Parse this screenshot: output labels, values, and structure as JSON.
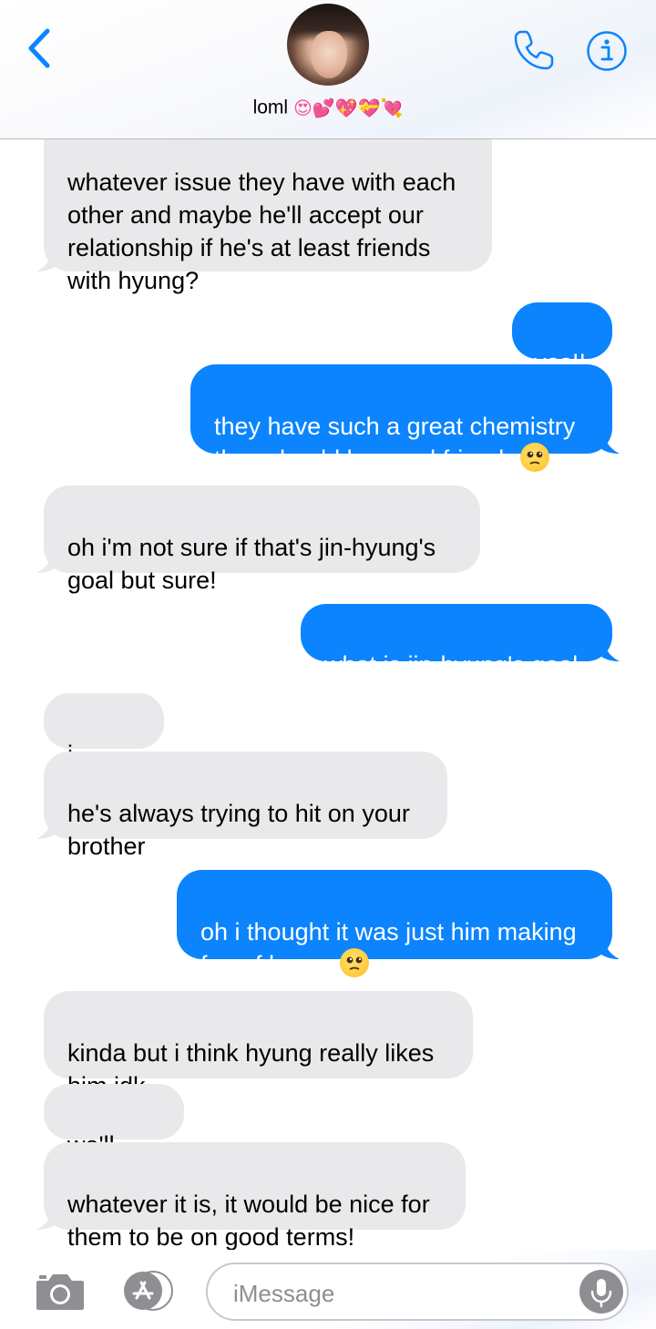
{
  "header": {
    "contact_name": "loml",
    "contact_emojis": "😍💕💖💝💘",
    "avatar_label": "contact photo"
  },
  "messages": [
    {
      "direction": "in",
      "text": "whatever issue they have with each\nother and maybe he'll accept our\nrelationship if he's at least friends\nwith hyung?"
    },
    {
      "direction": "out",
      "text": "yes!!"
    },
    {
      "direction": "out",
      "text": "they have such a great chemistry\nthey should be good friends",
      "emoji": "🥺"
    },
    {
      "direction": "in",
      "text": "oh i'm not sure if that's jin-hyung's\ngoal but sure!"
    },
    {
      "direction": "out",
      "text": "what is jin-hyung's goal"
    },
    {
      "direction": "in",
      "text": "i mean"
    },
    {
      "direction": "in",
      "text": "he's always trying to hit on your\nbrother"
    },
    {
      "direction": "out",
      "text": "oh i thought it was just him making\nfun of hyung",
      "emoji": "😂"
    },
    {
      "direction": "in",
      "text": "kinda but i think hyung really likes\nhim idk"
    },
    {
      "direction": "in",
      "text": "we'll see"
    },
    {
      "direction": "in",
      "text": "whatever it is, it would be nice for\nthem to be on good terms!"
    }
  ],
  "composer": {
    "placeholder": "iMessage",
    "value": ""
  },
  "colors": {
    "accent": "#0b84fe",
    "incoming_bubble": "#e9e9eb",
    "outgoing_bubble": "#0b84fe",
    "icon_gray": "#8e8e93"
  },
  "icons": {
    "back": "chevron-left-icon",
    "call": "phone-icon",
    "info": "info-icon",
    "camera": "camera-icon",
    "apps": "app-store-icon",
    "mic": "microphone-icon"
  }
}
